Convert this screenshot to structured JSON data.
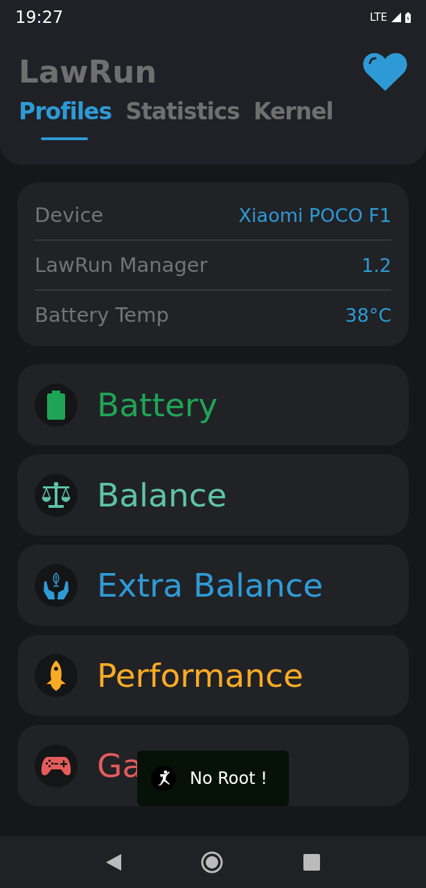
{
  "status_bar": {
    "time": "19:27",
    "network": "LTE"
  },
  "app_title": "LawRun",
  "tabs": [
    {
      "label": "Profiles",
      "selected": true
    },
    {
      "label": "Statistics",
      "selected": false
    },
    {
      "label": "Kernel",
      "selected": false
    }
  ],
  "info": [
    {
      "label": "Device",
      "value": "Xiaomi POCO F1"
    },
    {
      "label": "LawRun Manager",
      "value": "1.2"
    },
    {
      "label": "Battery Temp",
      "value": "38°C"
    }
  ],
  "profiles": [
    {
      "kind": "battery",
      "name": "Battery",
      "color": "#1fa456"
    },
    {
      "kind": "balance",
      "name": "Balance",
      "color": "#5ec4a4"
    },
    {
      "kind": "extra",
      "name": "Extra Balance",
      "color": "#2f9bd6"
    },
    {
      "kind": "performance",
      "name": "Performance",
      "color": "#f9ab25"
    },
    {
      "kind": "gaming",
      "name": "Ga",
      "color": "#e45c5a"
    }
  ],
  "toast": {
    "text": "No Root !"
  }
}
